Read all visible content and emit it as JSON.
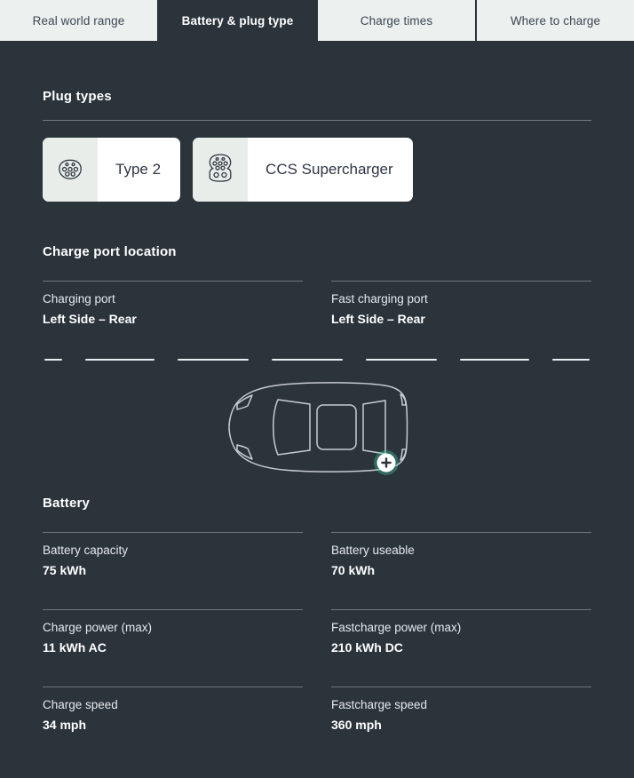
{
  "tabs": [
    {
      "label": "Real world range",
      "active": false
    },
    {
      "label": "Battery & plug type",
      "active": true
    },
    {
      "label": "Charge times",
      "active": false
    },
    {
      "label": "Where to charge",
      "active": false
    }
  ],
  "plug_types": {
    "heading": "Plug types",
    "cards": [
      {
        "label": "Type 2",
        "icon": "type2-plug-icon"
      },
      {
        "label": "CCS Supercharger",
        "icon": "ccs-plug-icon"
      }
    ]
  },
  "charge_port_location": {
    "heading": "Charge port location",
    "items": [
      {
        "label": "Charging port",
        "value": "Left Side – Rear"
      },
      {
        "label": "Fast charging port",
        "value": "Left Side – Rear"
      }
    ],
    "diagram": {
      "name": "car-top-view-diagram",
      "marker": "charge-port-marker",
      "marker_icon": "plus-icon"
    },
    "segments": [
      20,
      78,
      80,
      80,
      80,
      78,
      42
    ]
  },
  "battery": {
    "heading": "Battery",
    "rows": [
      [
        {
          "label": "Battery capacity",
          "value": "75 kWh"
        },
        {
          "label": "Battery useable",
          "value": "70 kWh"
        }
      ],
      [
        {
          "label": "Charge power (max)",
          "value": "11 kWh AC"
        },
        {
          "label": "Fastcharge power (max)",
          "value": "210 kWh DC"
        }
      ],
      [
        {
          "label": "Charge speed",
          "value": "34 mph"
        },
        {
          "label": "Fastcharge speed",
          "value": "360 mph"
        }
      ]
    ]
  },
  "colors": {
    "background": "#2b333b",
    "tab_inactive_bg": "#ecf0ee",
    "tab_inactive_text": "#3b4754",
    "card_bg": "#ffffff",
    "card_icon_bg": "#e8edea",
    "text_primary": "#ffffff",
    "divider": "#9aa3aa",
    "marker_accent": "#3fd0a2"
  }
}
